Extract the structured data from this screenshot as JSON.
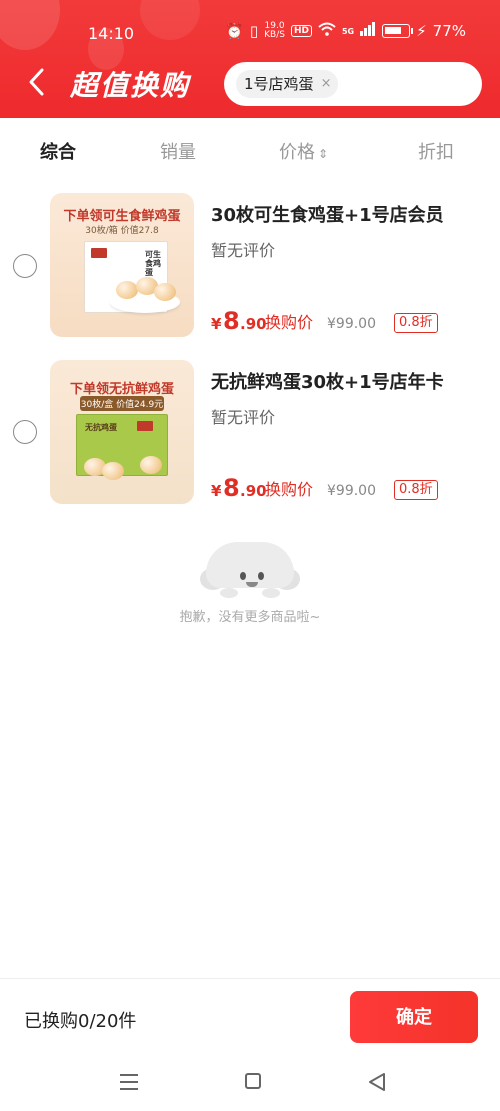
{
  "status_bar": {
    "time": "14:10",
    "net_speed": "19.0",
    "net_unit": "KB/S",
    "hd": "HD",
    "signal": "5G",
    "battery_percent": "77%",
    "battery_level": 0.77
  },
  "header": {
    "back_icon": "chevron-left-icon",
    "title": "超值换购",
    "search_chip": "1号店鸡蛋",
    "chip_close": "×"
  },
  "tabs": [
    {
      "label": "综合",
      "active": true
    },
    {
      "label": "销量",
      "active": false
    },
    {
      "label": "价格",
      "active": false,
      "icon": "sort-icon"
    },
    {
      "label": "折扣",
      "active": false
    }
  ],
  "products": [
    {
      "name": "30枚可生食鸡蛋+1号店会员",
      "review": "暂无评价",
      "price_symbol": "¥",
      "price_int": "8",
      "price_dec": ".90",
      "price_label": "换购价",
      "original_price": "¥99.00",
      "discount": "0.8折",
      "thumb_title": "下单领可生食鲜鸡蛋",
      "thumb_sub": "30枚/箱 价值27.8",
      "thumb_box_label": "可生食鸡蛋"
    },
    {
      "name": "无抗鲜鸡蛋30枚+1号店年卡",
      "review": "暂无评价",
      "price_symbol": "¥",
      "price_int": "8",
      "price_dec": ".90",
      "price_label": "换购价",
      "original_price": "¥99.00",
      "discount": "0.8折",
      "thumb_title": "下单领无抗鲜鸡蛋",
      "thumb_sub": "30枚/盒 价值24.9元",
      "thumb_box_label": "无抗鸡蛋"
    }
  ],
  "empty_state": {
    "text": "抱歉，没有更多商品啦~"
  },
  "bottom": {
    "count_text": "已换购0/20件",
    "confirm_label": "确定"
  },
  "colors": {
    "header_red": "#ee2a2d",
    "price_red": "#e02e24",
    "confirm_red": "#f4332a"
  }
}
